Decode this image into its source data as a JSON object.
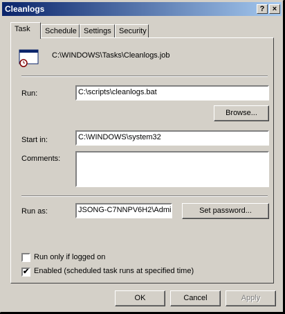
{
  "window": {
    "title": "Cleanlogs",
    "help_glyph": "?",
    "close_glyph": "×"
  },
  "tabs": [
    {
      "label": "Task"
    },
    {
      "label": "Schedule"
    },
    {
      "label": "Settings"
    },
    {
      "label": "Security"
    }
  ],
  "task": {
    "path": "C:\\WINDOWS\\Tasks\\Cleanlogs.job",
    "run_label": "Run:",
    "run_value": "C:\\scripts\\cleanlogs.bat",
    "browse_label": "Browse...",
    "start_in_label": "Start in:",
    "start_in_value": "C:\\WINDOWS\\system32",
    "comments_label": "Comments:",
    "comments_value": "",
    "run_as_label": "Run as:",
    "run_as_value": "JSONG-C7NNPV6H2\\Admi",
    "set_password_label": "Set password...",
    "run_only_logged_label": "Run only if logged on",
    "run_only_logged_checked": false,
    "enabled_label": "Enabled (scheduled task runs at specified time)",
    "enabled_checked": true,
    "check_glyph": "✔"
  },
  "footer": {
    "ok": "OK",
    "cancel": "Cancel",
    "apply": "Apply"
  }
}
